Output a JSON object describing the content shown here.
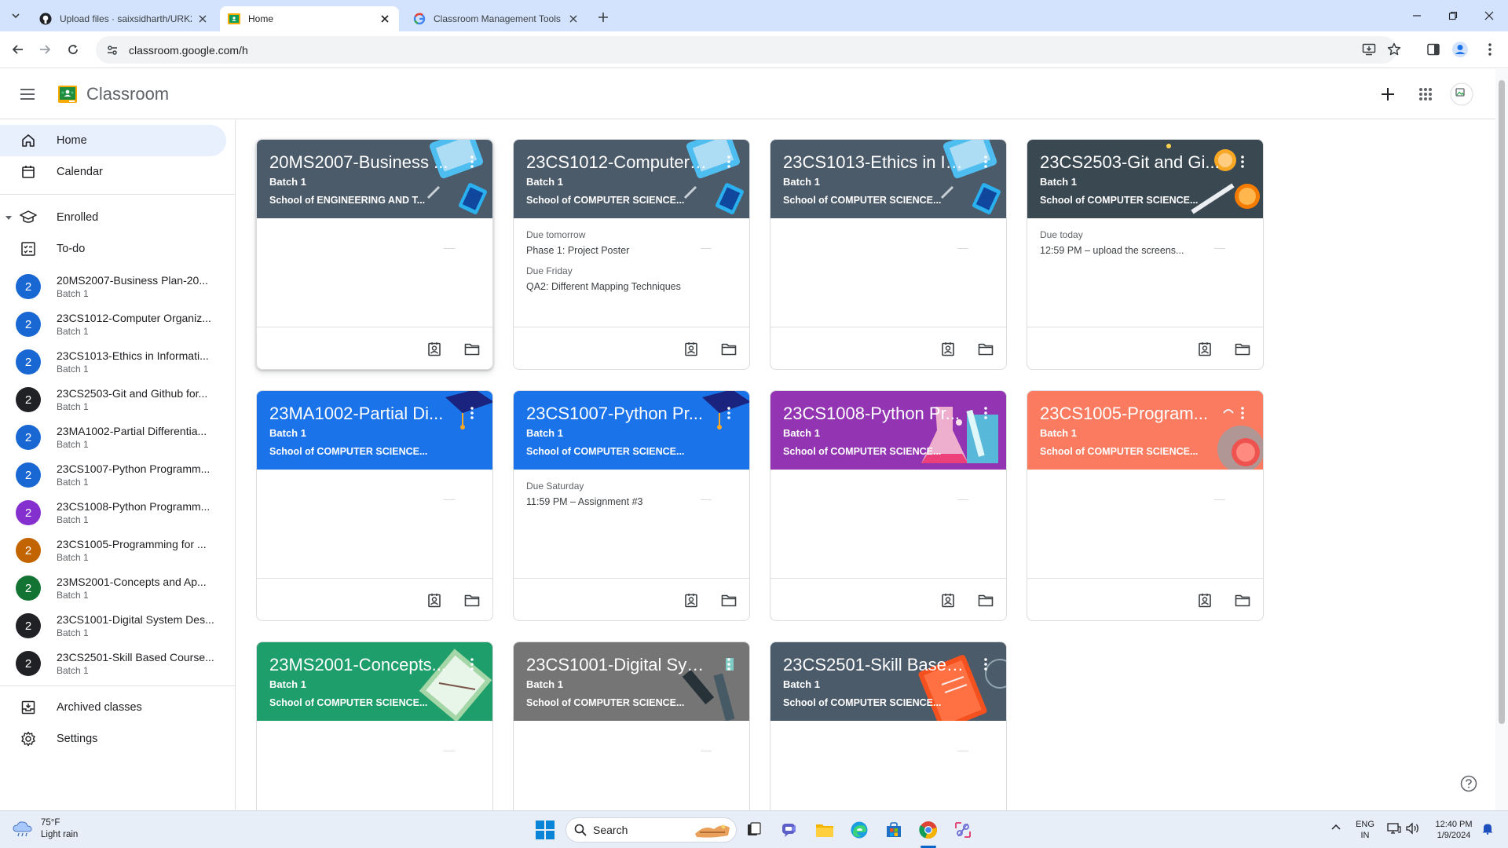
{
  "browser": {
    "tabs": [
      {
        "title": "Upload files · saixsidharth/URK2",
        "active": false
      },
      {
        "title": "Home",
        "active": true
      },
      {
        "title": "Classroom Management Tools & ",
        "active": false
      }
    ],
    "url": "classroom.google.com/h"
  },
  "app": {
    "title": "Classroom"
  },
  "sidebar": {
    "home_label": "Home",
    "calendar_label": "Calendar",
    "enrolled_label": "Enrolled",
    "todo_label": "To-do",
    "archived_label": "Archived classes",
    "settings_label": "Settings",
    "classes": [
      {
        "avatar": "2",
        "name": "20MS2007-Business Plan-20...",
        "sub": "Batch 1",
        "color": "#1967d2"
      },
      {
        "avatar": "2",
        "name": "23CS1012-Computer Organiz...",
        "sub": "Batch 1",
        "color": "#1967d2"
      },
      {
        "avatar": "2",
        "name": "23CS1013-Ethics in Informati...",
        "sub": "Batch 1",
        "color": "#1967d2"
      },
      {
        "avatar": "2",
        "name": "23CS2503-Git and Github for...",
        "sub": "Batch 1",
        "color": "#202124"
      },
      {
        "avatar": "2",
        "name": "23MA1002-Partial Differentia...",
        "sub": "Batch 1",
        "color": "#1967d2"
      },
      {
        "avatar": "2",
        "name": "23CS1007-Python Programm...",
        "sub": "Batch 1",
        "color": "#1967d2"
      },
      {
        "avatar": "2",
        "name": "23CS1008-Python Programm...",
        "sub": "Batch 1",
        "color": "#8430ce"
      },
      {
        "avatar": "2",
        "name": "23CS1005-Programming for ...",
        "sub": "Batch 1",
        "color": "#c26401"
      },
      {
        "avatar": "2",
        "name": "23MS2001-Concepts and Ap...",
        "sub": "Batch 1",
        "color": "#137333"
      },
      {
        "avatar": "2",
        "name": "23CS1001-Digital System Des...",
        "sub": "Batch 1",
        "color": "#202124"
      },
      {
        "avatar": "2",
        "name": "23CS2501-Skill Based Course...",
        "sub": "Batch 1",
        "color": "#202124"
      }
    ]
  },
  "cards": [
    {
      "title": "20MS2007-Business ...",
      "batch": "Batch 1",
      "school": "School of ENGINEERING AND T...",
      "color": "#4c5b6a",
      "art": "tech",
      "due": []
    },
    {
      "title": "23CS1012-Computer ...",
      "batch": "Batch 1",
      "school": "School of COMPUTER SCIENCE...",
      "color": "#4c5b6a",
      "art": "tech",
      "due": [
        {
          "label": "Due tomorrow",
          "item": "Phase 1: Project Poster"
        },
        {
          "label": "Due Friday",
          "item": "QA2: Different Mapping Techniques"
        }
      ]
    },
    {
      "title": "23CS1013-Ethics in In...",
      "batch": "Batch 1",
      "school": "School of COMPUTER SCIENCE...",
      "color": "#4c5b6a",
      "art": "tech",
      "due": []
    },
    {
      "title": "23CS2503-Git and Gi...",
      "batch": "Batch 1",
      "school": "School of COMPUTER SCIENCE...",
      "color": "#3a4852",
      "art": "orange",
      "due": [
        {
          "label": "Due today",
          "item": "12:59 PM – upload the screens..."
        }
      ]
    },
    {
      "title": "23MA1002-Partial Di...",
      "batch": "Batch 1",
      "school": "School of COMPUTER SCIENCE...",
      "color": "#1a73e8",
      "art": "grad",
      "due": []
    },
    {
      "title": "23CS1007-Python Pr...",
      "batch": "Batch 1",
      "school": "School of COMPUTER SCIENCE...",
      "color": "#1a73e8",
      "art": "grad",
      "due": [
        {
          "label": "Due Saturday",
          "item": "11:59 PM – Assignment #3"
        }
      ]
    },
    {
      "title": "23CS1008-Python Pr...",
      "batch": "Batch 1",
      "school": "School of COMPUTER SCIENCE...",
      "color": "#9334b2",
      "art": "flask",
      "due": []
    },
    {
      "title": "23CS1005-Program...",
      "batch": "Batch 1",
      "school": "School of COMPUTER SCIENCE...",
      "color": "#fa7b5f",
      "art": "circle",
      "due": []
    },
    {
      "title": "23MS2001-Concepts...",
      "batch": "Batch 1",
      "school": "School of COMPUTER SCIENCE...",
      "color": "#1e9e6b",
      "art": "book",
      "due": []
    },
    {
      "title": "23CS1001-Digital Sys...",
      "batch": "Batch 1",
      "school": "School of COMPUTER SCIENCE...",
      "color": "#757575",
      "art": "pens",
      "due": []
    },
    {
      "title": "23CS2501-Skill Based...",
      "batch": "Batch 1",
      "school": "School of COMPUTER SCIENCE...",
      "color": "#4c5b6a",
      "art": "redbook",
      "due": []
    }
  ],
  "taskbar": {
    "weather_temp": "75°F",
    "weather_desc": "Light rain",
    "search_label": "Search",
    "lang_top": "ENG",
    "lang_bottom": "IN",
    "time": "12:40 PM",
    "date": "1/9/2024"
  }
}
